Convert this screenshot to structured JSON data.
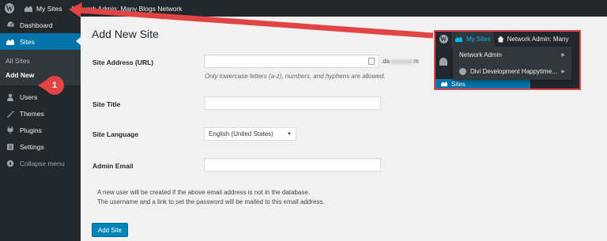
{
  "admin_bar": {
    "my_sites": "My Sites",
    "network_admin": "Network Admin: Many Blogs Network"
  },
  "sidebar": {
    "items": [
      {
        "label": "Dashboard",
        "icon": "dashboard-icon"
      },
      {
        "label": "Sites",
        "icon": "sites-icon",
        "current": true
      },
      {
        "label": "Users",
        "icon": "users-icon"
      },
      {
        "label": "Themes",
        "icon": "themes-icon"
      },
      {
        "label": "Plugins",
        "icon": "plugins-icon"
      },
      {
        "label": "Settings",
        "icon": "settings-icon"
      },
      {
        "label": "Collapse menu",
        "icon": "collapse-icon"
      }
    ],
    "submenu": [
      {
        "label": "All Sites"
      },
      {
        "label": "Add New",
        "active": true
      }
    ]
  },
  "main": {
    "title": "Add New Site",
    "site_address_label": "Site Address (URL)",
    "site_address_value": "",
    "domain_suffix_start": ".da",
    "domain_suffix_end": "m",
    "site_address_help": "Only lowercase letters (a-z), numbers, and hyphens are allowed.",
    "site_title_label": "Site Title",
    "site_title_value": "",
    "site_language_label": "Site Language",
    "site_language_value": "English (United States)",
    "admin_email_label": "Admin Email",
    "admin_email_value": "",
    "note_line1": "A new user will be created if the above email address is not in the database.",
    "note_line2": "The username and a link to set the password will be mailed to this email address.",
    "submit_label": "Add Site"
  },
  "callout": {
    "my_sites": "My Sites",
    "network_admin": "Network Admin: Many",
    "dropdown": [
      {
        "label": "Network Admin"
      },
      {
        "label": "Divi Development Happytime..."
      }
    ],
    "sites_label": "Sites"
  },
  "annotation": {
    "step": "1",
    "color": "#e04444"
  },
  "colors": {
    "adminbar": "#23282d",
    "accent": "#0073aa",
    "button": "#0085ba"
  }
}
